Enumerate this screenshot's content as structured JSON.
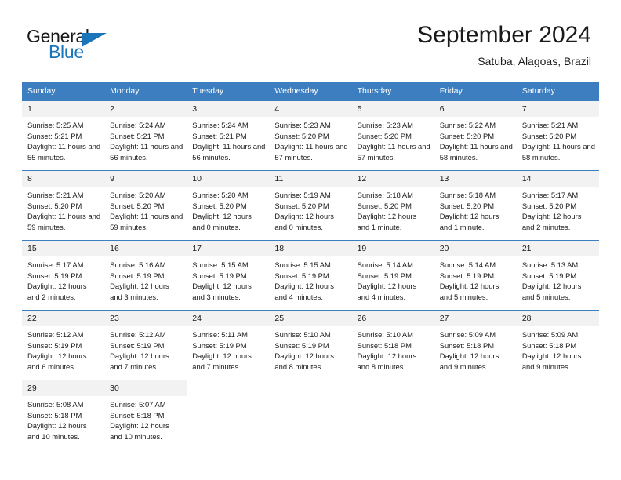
{
  "brand": {
    "name_part1": "General",
    "name_part2": "Blue",
    "triangle_icon": "triangle-icon",
    "color_dark": "#1a1a1a",
    "color_blue": "#1b75bb"
  },
  "header": {
    "title": "September 2024",
    "subtitle": "Satuba, Alagoas, Brazil"
  },
  "theme": {
    "header_row_bg": "#3c7ebf",
    "daynum_bg": "#f2f2f2",
    "grid_line": "#3c7ebf",
    "text": "#1a1a1a"
  },
  "weekday_headers": [
    "Sunday",
    "Monday",
    "Tuesday",
    "Wednesday",
    "Thursday",
    "Friday",
    "Saturday"
  ],
  "labels": {
    "sunrise_prefix": "Sunrise:",
    "sunset_prefix": "Sunset:",
    "daylight_prefix": "Daylight:"
  },
  "weeks": [
    [
      {
        "day": "1",
        "sunrise": "Sunrise: 5:25 AM",
        "sunset": "Sunset: 5:21 PM",
        "daylight": "Daylight: 11 hours and 55 minutes."
      },
      {
        "day": "2",
        "sunrise": "Sunrise: 5:24 AM",
        "sunset": "Sunset: 5:21 PM",
        "daylight": "Daylight: 11 hours and 56 minutes."
      },
      {
        "day": "3",
        "sunrise": "Sunrise: 5:24 AM",
        "sunset": "Sunset: 5:21 PM",
        "daylight": "Daylight: 11 hours and 56 minutes."
      },
      {
        "day": "4",
        "sunrise": "Sunrise: 5:23 AM",
        "sunset": "Sunset: 5:20 PM",
        "daylight": "Daylight: 11 hours and 57 minutes."
      },
      {
        "day": "5",
        "sunrise": "Sunrise: 5:23 AM",
        "sunset": "Sunset: 5:20 PM",
        "daylight": "Daylight: 11 hours and 57 minutes."
      },
      {
        "day": "6",
        "sunrise": "Sunrise: 5:22 AM",
        "sunset": "Sunset: 5:20 PM",
        "daylight": "Daylight: 11 hours and 58 minutes."
      },
      {
        "day": "7",
        "sunrise": "Sunrise: 5:21 AM",
        "sunset": "Sunset: 5:20 PM",
        "daylight": "Daylight: 11 hours and 58 minutes."
      }
    ],
    [
      {
        "day": "8",
        "sunrise": "Sunrise: 5:21 AM",
        "sunset": "Sunset: 5:20 PM",
        "daylight": "Daylight: 11 hours and 59 minutes."
      },
      {
        "day": "9",
        "sunrise": "Sunrise: 5:20 AM",
        "sunset": "Sunset: 5:20 PM",
        "daylight": "Daylight: 11 hours and 59 minutes."
      },
      {
        "day": "10",
        "sunrise": "Sunrise: 5:20 AM",
        "sunset": "Sunset: 5:20 PM",
        "daylight": "Daylight: 12 hours and 0 minutes."
      },
      {
        "day": "11",
        "sunrise": "Sunrise: 5:19 AM",
        "sunset": "Sunset: 5:20 PM",
        "daylight": "Daylight: 12 hours and 0 minutes."
      },
      {
        "day": "12",
        "sunrise": "Sunrise: 5:18 AM",
        "sunset": "Sunset: 5:20 PM",
        "daylight": "Daylight: 12 hours and 1 minute."
      },
      {
        "day": "13",
        "sunrise": "Sunrise: 5:18 AM",
        "sunset": "Sunset: 5:20 PM",
        "daylight": "Daylight: 12 hours and 1 minute."
      },
      {
        "day": "14",
        "sunrise": "Sunrise: 5:17 AM",
        "sunset": "Sunset: 5:20 PM",
        "daylight": "Daylight: 12 hours and 2 minutes."
      }
    ],
    [
      {
        "day": "15",
        "sunrise": "Sunrise: 5:17 AM",
        "sunset": "Sunset: 5:19 PM",
        "daylight": "Daylight: 12 hours and 2 minutes."
      },
      {
        "day": "16",
        "sunrise": "Sunrise: 5:16 AM",
        "sunset": "Sunset: 5:19 PM",
        "daylight": "Daylight: 12 hours and 3 minutes."
      },
      {
        "day": "17",
        "sunrise": "Sunrise: 5:15 AM",
        "sunset": "Sunset: 5:19 PM",
        "daylight": "Daylight: 12 hours and 3 minutes."
      },
      {
        "day": "18",
        "sunrise": "Sunrise: 5:15 AM",
        "sunset": "Sunset: 5:19 PM",
        "daylight": "Daylight: 12 hours and 4 minutes."
      },
      {
        "day": "19",
        "sunrise": "Sunrise: 5:14 AM",
        "sunset": "Sunset: 5:19 PM",
        "daylight": "Daylight: 12 hours and 4 minutes."
      },
      {
        "day": "20",
        "sunrise": "Sunrise: 5:14 AM",
        "sunset": "Sunset: 5:19 PM",
        "daylight": "Daylight: 12 hours and 5 minutes."
      },
      {
        "day": "21",
        "sunrise": "Sunrise: 5:13 AM",
        "sunset": "Sunset: 5:19 PM",
        "daylight": "Daylight: 12 hours and 5 minutes."
      }
    ],
    [
      {
        "day": "22",
        "sunrise": "Sunrise: 5:12 AM",
        "sunset": "Sunset: 5:19 PM",
        "daylight": "Daylight: 12 hours and 6 minutes."
      },
      {
        "day": "23",
        "sunrise": "Sunrise: 5:12 AM",
        "sunset": "Sunset: 5:19 PM",
        "daylight": "Daylight: 12 hours and 7 minutes."
      },
      {
        "day": "24",
        "sunrise": "Sunrise: 5:11 AM",
        "sunset": "Sunset: 5:19 PM",
        "daylight": "Daylight: 12 hours and 7 minutes."
      },
      {
        "day": "25",
        "sunrise": "Sunrise: 5:10 AM",
        "sunset": "Sunset: 5:19 PM",
        "daylight": "Daylight: 12 hours and 8 minutes."
      },
      {
        "day": "26",
        "sunrise": "Sunrise: 5:10 AM",
        "sunset": "Sunset: 5:18 PM",
        "daylight": "Daylight: 12 hours and 8 minutes."
      },
      {
        "day": "27",
        "sunrise": "Sunrise: 5:09 AM",
        "sunset": "Sunset: 5:18 PM",
        "daylight": "Daylight: 12 hours and 9 minutes."
      },
      {
        "day": "28",
        "sunrise": "Sunrise: 5:09 AM",
        "sunset": "Sunset: 5:18 PM",
        "daylight": "Daylight: 12 hours and 9 minutes."
      }
    ],
    [
      {
        "day": "29",
        "sunrise": "Sunrise: 5:08 AM",
        "sunset": "Sunset: 5:18 PM",
        "daylight": "Daylight: 12 hours and 10 minutes."
      },
      {
        "day": "30",
        "sunrise": "Sunrise: 5:07 AM",
        "sunset": "Sunset: 5:18 PM",
        "daylight": "Daylight: 12 hours and 10 minutes."
      },
      {
        "day": "",
        "sunrise": "",
        "sunset": "",
        "daylight": ""
      },
      {
        "day": "",
        "sunrise": "",
        "sunset": "",
        "daylight": ""
      },
      {
        "day": "",
        "sunrise": "",
        "sunset": "",
        "daylight": ""
      },
      {
        "day": "",
        "sunrise": "",
        "sunset": "",
        "daylight": ""
      },
      {
        "day": "",
        "sunrise": "",
        "sunset": "",
        "daylight": ""
      }
    ]
  ]
}
